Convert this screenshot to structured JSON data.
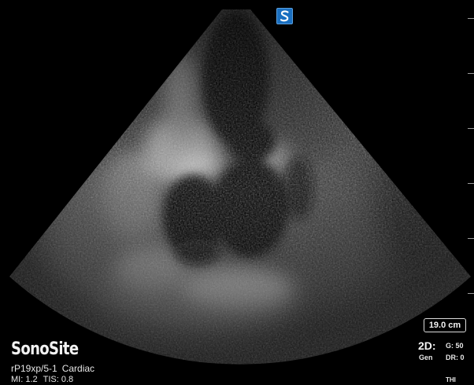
{
  "colors": {
    "background": "#000000",
    "marker_blue": "#1a6fc0",
    "text": "#e8e8e8"
  },
  "orientation_marker": {
    "icon": "sonosite-s-logo-icon"
  },
  "brand": {
    "name": "SonoSite"
  },
  "probe": {
    "transducer": "rP19xp/5-1",
    "exam": "Cardiac"
  },
  "indices": {
    "mi": "MI: 1.2",
    "tis": "TIS: 0.8"
  },
  "imaging": {
    "depth": "19.0 cm",
    "mode": "2D:",
    "preset": "Gen",
    "gain": "G: 50",
    "dynamic_range": "DR: 0",
    "thi": "THI"
  }
}
